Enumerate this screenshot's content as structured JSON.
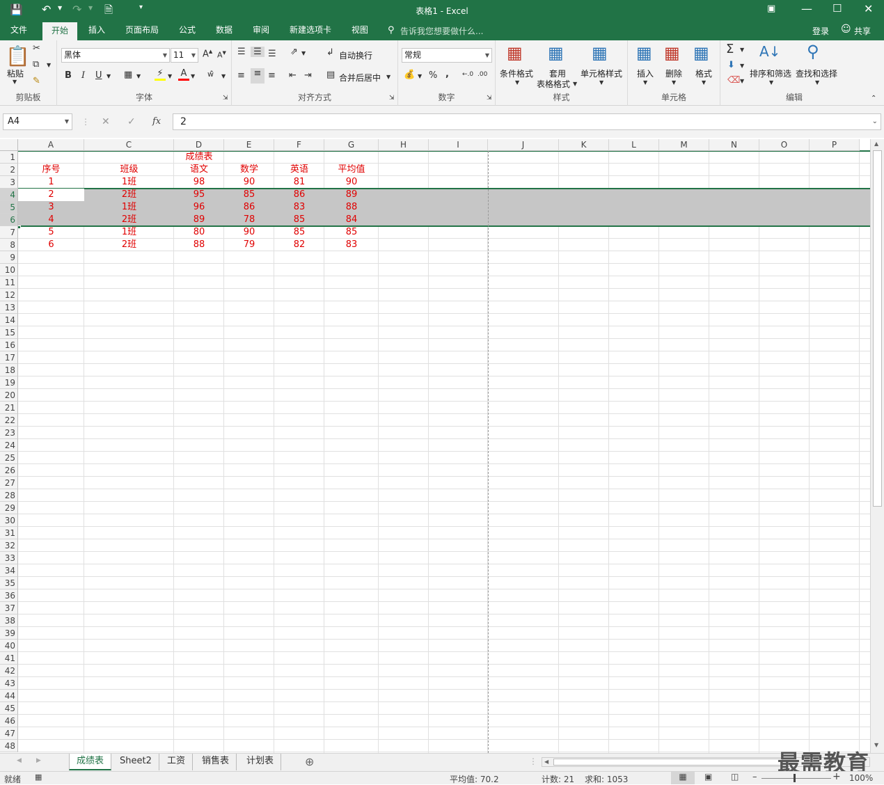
{
  "window": {
    "title": "表格1 - Excel",
    "login": "登录",
    "share": "共享"
  },
  "tabs": [
    "文件",
    "开始",
    "插入",
    "页面布局",
    "公式",
    "数据",
    "审阅",
    "新建选项卡",
    "视图"
  ],
  "tellme": "告诉我您想要做什么...",
  "ribbon": {
    "clipboard": {
      "paste": "粘贴",
      "label": "剪贴板"
    },
    "font": {
      "name": "黑体",
      "size": "11",
      "label": "字体"
    },
    "align": {
      "wrap": "自动换行",
      "merge": "合并后居中",
      "label": "对齐方式"
    },
    "number": {
      "format": "常规",
      "label": "数字"
    },
    "styles": {
      "cond": "条件格式",
      "table1": "套用",
      "table2": "表格格式",
      "cellstyle": "单元格样式",
      "label": "样式"
    },
    "cells": {
      "insert": "插入",
      "delete": "删除",
      "format": "格式",
      "label": "单元格"
    },
    "edit": {
      "sort": "排序和筛选",
      "find": "查找和选择",
      "label": "编辑"
    }
  },
  "formula": {
    "namebox": "A4",
    "value": "2"
  },
  "columns": [
    "A",
    "C",
    "D",
    "E",
    "F",
    "G",
    "H",
    "I",
    "J",
    "K",
    "L",
    "M",
    "N",
    "O",
    "P"
  ],
  "rows": [
    "1",
    "2",
    "3",
    "4",
    "5",
    "6",
    "7",
    "8",
    "9",
    "10",
    "11",
    "12",
    "13",
    "14",
    "15",
    "16",
    "17",
    "18",
    "19",
    "20",
    "21",
    "22",
    "23",
    "24",
    "25",
    "26",
    "27",
    "28",
    "29",
    "30",
    "31",
    "32",
    "33",
    "34",
    "35",
    "36",
    "37",
    "38",
    "39",
    "40",
    "41",
    "42",
    "43",
    "44",
    "45",
    "46",
    "47",
    "48"
  ],
  "sheet": {
    "title": "成绩表",
    "headers": [
      "序号",
      "班级",
      "语文",
      "数学",
      "英语",
      "平均值"
    ],
    "data": [
      [
        "1",
        "1班",
        "98",
        "90",
        "81",
        "90"
      ],
      [
        "2",
        "2班",
        "95",
        "85",
        "86",
        "89"
      ],
      [
        "3",
        "1班",
        "96",
        "86",
        "83",
        "88"
      ],
      [
        "4",
        "2班",
        "89",
        "78",
        "85",
        "84"
      ],
      [
        "5",
        "1班",
        "80",
        "90",
        "85",
        "85"
      ],
      [
        "6",
        "2班",
        "88",
        "79",
        "82",
        "83"
      ]
    ]
  },
  "sheettabs": [
    "成绩表",
    "Sheet2",
    "工资",
    "销售表",
    "计划表"
  ],
  "watermark": "最需教育",
  "status": {
    "ready": "就绪",
    "avg": "平均值: 70.2",
    "count": "计数: 21",
    "sum": "求和: 1053",
    "zoom": "100%"
  }
}
